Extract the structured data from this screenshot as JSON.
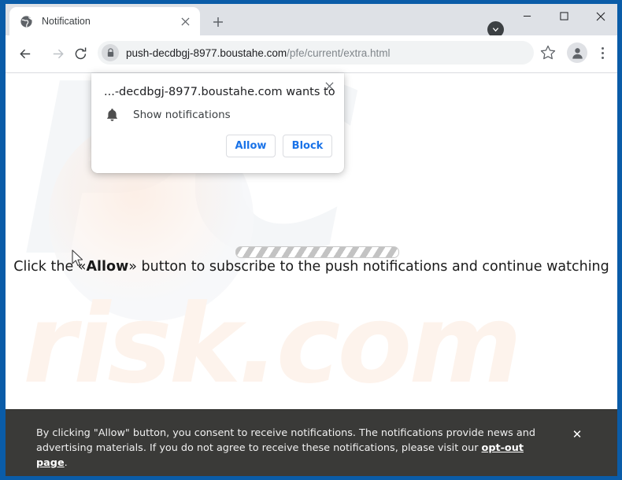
{
  "browser": {
    "tab": {
      "title": "Notification",
      "favicon": "globe-icon",
      "close_label": "×"
    },
    "new_tab_label": "+",
    "window_controls": {
      "minimize": "–",
      "maximize": "□",
      "close": "×"
    },
    "toolbar": {
      "back": "←",
      "forward": "→",
      "reload": "↻",
      "lock": "lock-icon",
      "url_host": "push-decdbgj-8977.boustahe.com",
      "url_path": "/pfe/current/extra.html",
      "bookmark": "star-icon",
      "avatar": "person-icon",
      "menu": "three-dot-menu-icon"
    }
  },
  "permission_dialog": {
    "origin": "...-decdbgj-8977.boustahe.com wants to",
    "permission_icon": "bell-icon",
    "permission_label": "Show notifications",
    "allow_label": "Allow",
    "block_label": "Block",
    "close_label": "×"
  },
  "page": {
    "instruction_prefix": "Click the «",
    "instruction_bold": "Allow",
    "instruction_suffix": "» button to subscribe to the push notifications and continue watching",
    "loading_bar": "striped-progress-bar",
    "watermark_top": "PC",
    "watermark_bottom": "risk.com",
    "cursor": "arrow-cursor"
  },
  "consent_banner": {
    "text_part1": "By clicking \"Allow\" button, you consent to receive notifications. The notifications provide news and advertising materials. If you do not agree to receive these notifications, please visit our ",
    "link_label": "opt-out page",
    "text_part2": ".",
    "close_label": "✕"
  },
  "colors": {
    "window_border": "#0a5ca8",
    "tabstrip": "#dee1e6",
    "accent_blue": "#1a73e8",
    "banner_bg": "#3a3a38",
    "omnibox_bg": "#f1f3f4"
  }
}
